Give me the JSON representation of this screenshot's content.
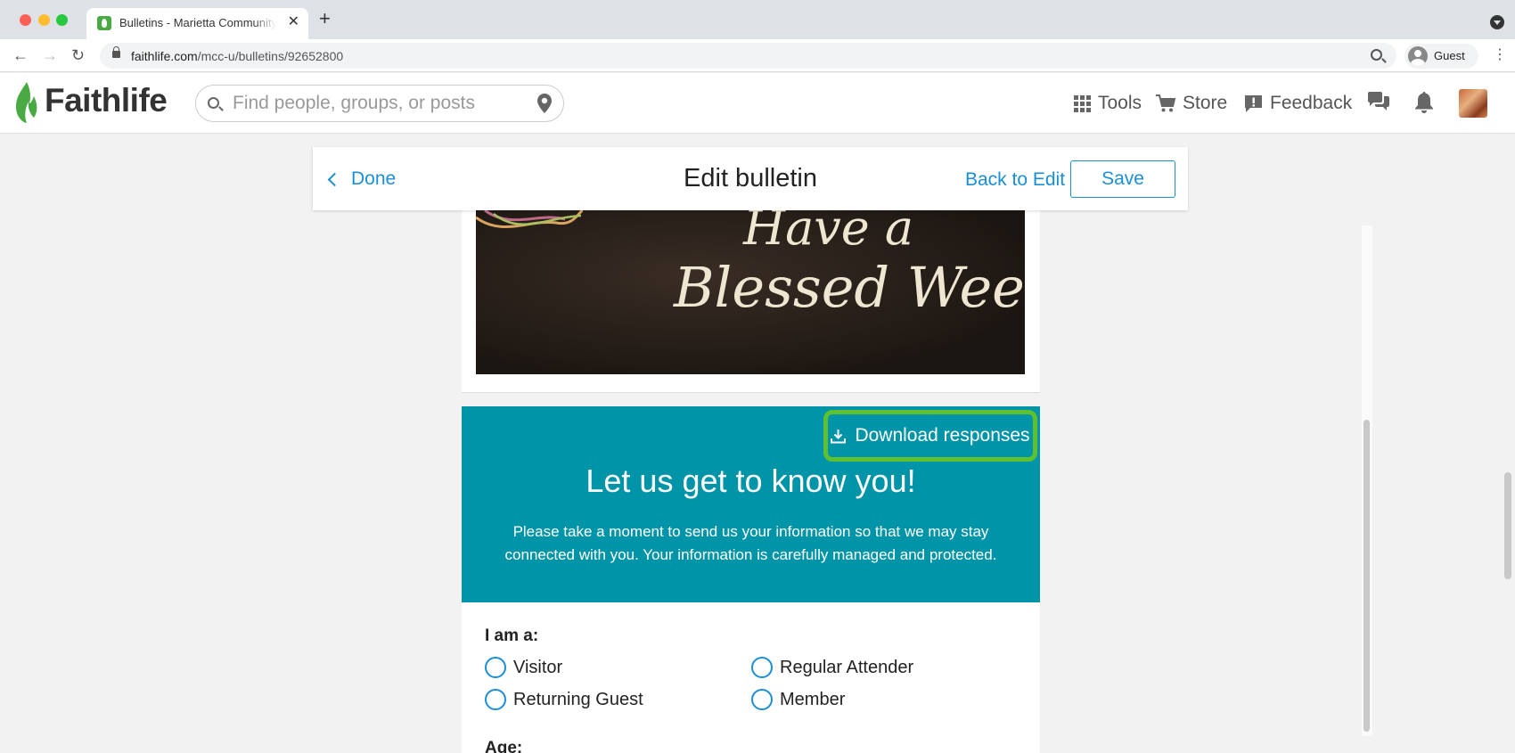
{
  "browser": {
    "tab_title": "Bulletins - Marietta Community",
    "tab_close": "✕",
    "new_tab": "+",
    "url_domain": "faithlife.com",
    "url_path": "/mcc-u/bulletins/92652800",
    "profile_name": "Guest",
    "nav_back": "←",
    "nav_forward": "→",
    "nav_reload": "↻",
    "menu": "⋮"
  },
  "site_header": {
    "logo": "Faithlife",
    "search": {
      "placeholder": "Find people, groups, or posts"
    },
    "nav": [
      {
        "label": "Tools",
        "icon": "grid-icon"
      },
      {
        "label": "Store",
        "icon": "cart-icon"
      },
      {
        "label": "Feedback",
        "icon": "feedback-icon"
      }
    ],
    "icons": [
      "chat-icon",
      "bell-icon",
      "avatar"
    ]
  },
  "editor_bar": {
    "done_label": "Done",
    "title": "Edit bulletin",
    "back_to_edit_label": "Back to Edit",
    "save_label": "Save"
  },
  "image_card": {
    "chalk_line_1": "Have a",
    "chalk_line_2": "Blessed Week!"
  },
  "form": {
    "download_label": "Download responses",
    "heading": "Let us get to know you!",
    "intro": "Please take a moment to send us your information so that we may stay connected with you. Your information is carefully managed and protected.",
    "i_am_label": "I am a:",
    "options": [
      "Visitor",
      "Regular Attender",
      "Returning Guest",
      "Member"
    ],
    "age_label": "Age:"
  },
  "colors": {
    "accent_blue": "#1a8fd8",
    "form_teal": "#0094a8",
    "highlight_green": "#5fc130",
    "brand_green": "#49a942"
  }
}
